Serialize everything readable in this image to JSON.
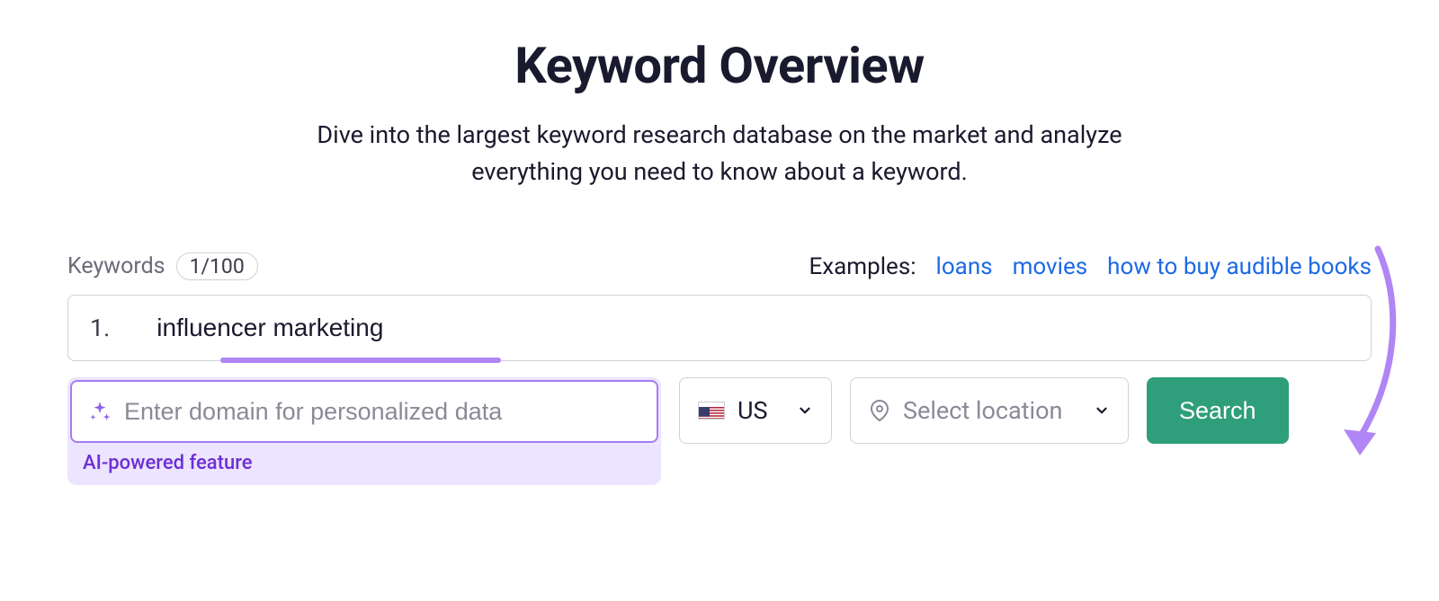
{
  "header": {
    "title": "Keyword Overview",
    "subtitle": "Dive into the largest keyword research database on the market and analyze everything you need to know about a keyword."
  },
  "keywords": {
    "label": "Keywords",
    "count": "1/100",
    "examples_label": "Examples:",
    "examples": [
      "loans",
      "movies",
      "how to buy audible books"
    ],
    "items": [
      {
        "index": "1.",
        "value": "influencer marketing"
      }
    ]
  },
  "domain": {
    "placeholder": "Enter domain for personalized data",
    "ai_caption": "AI-powered feature"
  },
  "country": {
    "code": "US"
  },
  "location": {
    "placeholder": "Select location"
  },
  "actions": {
    "search": "Search"
  },
  "colors": {
    "accent_purple": "#a77cf0",
    "accent_green": "#2f9e7a",
    "link_blue": "#1d6ae5"
  }
}
